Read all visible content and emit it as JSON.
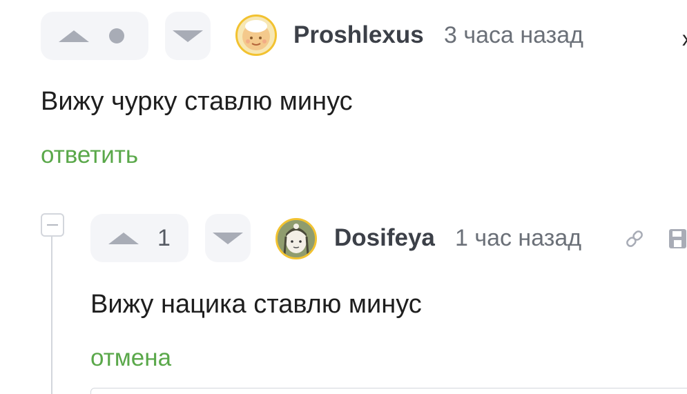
{
  "comment_1": {
    "votes_display": "",
    "username": "Proshlexus",
    "timestamp": "3 часа назад",
    "text": "Вижу чурку ставлю минус",
    "action_label": "ответить"
  },
  "comment_2": {
    "votes_display": "1",
    "username": "Dosifeya",
    "timestamp": "1 час назад",
    "text": "Вижу нацика ставлю минус",
    "action_label": "отмена"
  },
  "edge_glyph": "x",
  "colors": {
    "accent_link": "#5aa84a",
    "vote_icon": "#a8acb6",
    "avatar_border": "#f2c230"
  },
  "icons": [
    "upvote-icon",
    "downvote-icon",
    "link-icon",
    "save-icon",
    "collapse-icon"
  ]
}
